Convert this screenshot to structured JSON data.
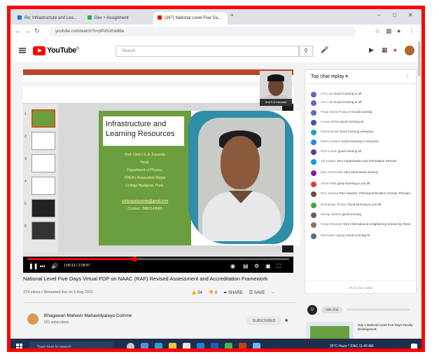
{
  "browser": {
    "tabs": [
      {
        "label": "Re: Infrastructure and Lea...",
        "active": false,
        "fav_color": "#1a73e8"
      },
      {
        "label": "Dev + Assignment",
        "active": false,
        "fav_color": "#34a853"
      },
      {
        "label": "(267) National Level Five Da...",
        "active": true,
        "fav_color": "#ff0000"
      }
    ],
    "new_tab": "+",
    "url": "youtube.com/watch?v=pPoN1Kw8be"
  },
  "youtube": {
    "logo_text": "YouTube",
    "region": "IN",
    "search_placeholder": "Search"
  },
  "slide": {
    "title": "Infrastructure and Learning Resources",
    "lines": [
      "Prof. (Smt.) S. A. Karande",
      "Head,",
      "Department of Physics,",
      "PDEA's Annasaheb Magar",
      "College Hadapsar, Pune.",
      "",
      "saharayakarande@gmail.com",
      "Contact : 9860143683"
    ],
    "webcam_label": "Smt.S.A.Karande"
  },
  "player": {
    "time": "1:05:13 / 2:28:47",
    "progress_fraction": 0.41
  },
  "video": {
    "title": "National Level Five Days Virtual FDP on NAAC (RAF) Revised Assessment and Accreditation Framework",
    "meta": "374 views • Streamed live on 5 Aug 2021",
    "likes": "34",
    "dislikes": "0",
    "share": "SHARE",
    "save": "SAVE",
    "more": "..."
  },
  "channel": {
    "name": "Bhagawan Mahavir Mahavidyalaya Comme",
    "subscribers": "521 subscribers",
    "subscribe_label": "SUBSCRIBED"
  },
  "chat": {
    "header": "Top chat replay",
    "messages": [
      {
        "author": "Anil Lute",
        "text": "Good morning to all",
        "color": "#7e57c2"
      },
      {
        "author": "Anil Lute",
        "text": "Good morning to all",
        "color": "#7e57c2"
      },
      {
        "author": "Pooja Nachi Pratap M",
        "text": "Good morning",
        "color": "#5c6bc0"
      },
      {
        "author": "Anoop Mehta",
        "text": "good morning sir",
        "color": "#3f51b5"
      },
      {
        "author": "Kamal Desai",
        "text": "Good morning everyone",
        "color": "#26a69a"
      },
      {
        "author": "Neha Kulkarni",
        "text": "Good morning to everyone",
        "color": "#1e88e5"
      },
      {
        "author": "Ravi Kumar",
        "text": "good morning all",
        "color": "#5e35b1"
      },
      {
        "author": "Ajit Kadam",
        "text": "Very Organization and Information Session",
        "color": "#039be5"
      },
      {
        "author": "Balu Deshmukh",
        "text": "Very Informative session",
        "color": "#7b1fa2"
      },
      {
        "author": "Vinod Pillai",
        "text": "good morning to you all",
        "color": "#e53935"
      },
      {
        "author": "Ravi Sawant",
        "text": "Ravi Sawant, Chinmay Education Society, Principal",
        "color": "#6d4c41"
      },
      {
        "author": "Dhananjay Gholve",
        "text": "Good Morning to you all",
        "color": "#43a047"
      },
      {
        "author": "Shivaji Jadhav",
        "text": "good morning",
        "color": "#795548"
      },
      {
        "author": "Vinay Dhamale",
        "text": "Very Informative & enlightening session by Resource Sir",
        "color": "#8d6e63"
      },
      {
        "author": "Bhanudas Jagtap",
        "text": "Good morning sir",
        "color": "#546e7a"
      }
    ],
    "footer": "Show chat replay",
    "input_avatar": "D",
    "input_chip": "Hide chat"
  },
  "up_next": {
    "title": "Day 1 National Level Five Days Faculty Development"
  },
  "taskbar": {
    "search": "Type here to search",
    "tray": "25°C  Haze  ^  ENG  11:40 AM"
  }
}
